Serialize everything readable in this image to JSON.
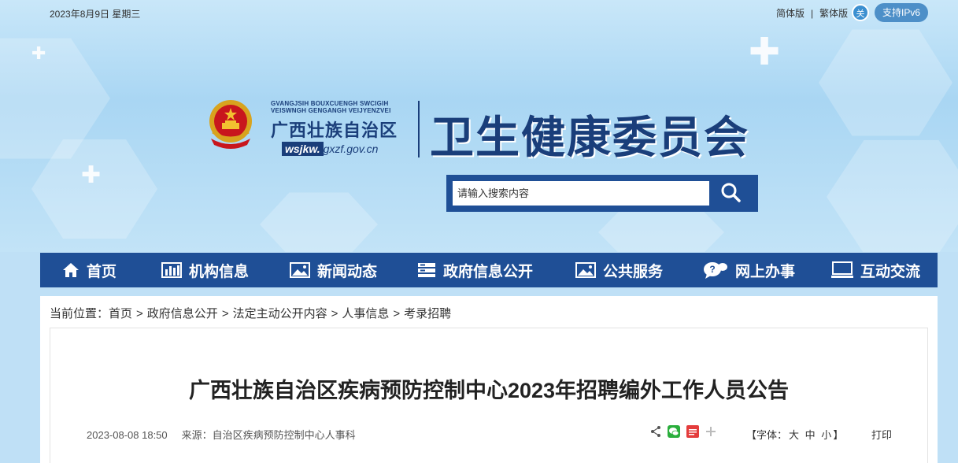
{
  "topbar": {
    "date": "2023年8月9日  星期三",
    "simplified": "简体版",
    "separator": "|",
    "traditional": "繁体版",
    "care_icon_text": "关",
    "ipv6": "支持IPv6"
  },
  "branding": {
    "region_small_1": "GVANGJSIH BOUXCUENGH SWCIGIH",
    "region_small_2": "VEISWNGH GENGANGH VEIJYENZVEI",
    "region_name": "广西壮族自治区",
    "domain_bold": "wsjkw.",
    "domain_rest": "gxzf.gov.cn",
    "site_title": "卫生健康委员会"
  },
  "search": {
    "placeholder": "请输入搜索内容"
  },
  "nav": [
    {
      "label": "首页",
      "icon": "home-icon"
    },
    {
      "label": "机构信息",
      "icon": "bar-chart-icon"
    },
    {
      "label": "新闻动态",
      "icon": "image-icon"
    },
    {
      "label": "政府信息公开",
      "icon": "server-icon"
    },
    {
      "label": "公共服务",
      "icon": "image-icon"
    },
    {
      "label": "网上办事",
      "icon": "chat-icon"
    },
    {
      "label": "互动交流",
      "icon": "monitor-icon"
    }
  ],
  "breadcrumb": {
    "prefix": "当前位置：",
    "items": [
      "首页",
      "政府信息公开",
      "法定主动公开内容",
      "人事信息",
      "考录招聘"
    ],
    "sep": ">"
  },
  "article": {
    "title": "广西壮族自治区疾病预防控制中心2023年招聘编外工作人员公告",
    "datetime": "2023-08-08 18:50",
    "source": "来源：自治区疾病预防控制中心人事科",
    "font_label_open": "【字体：",
    "font_large": "大",
    "font_medium": "中",
    "font_small": "小",
    "font_label_close": "】",
    "print": "打印"
  },
  "colors": {
    "nav_bg": "#1f4f96",
    "title_blue": "#1a3e7a",
    "ipv6_bg": "#4d8fc8"
  }
}
